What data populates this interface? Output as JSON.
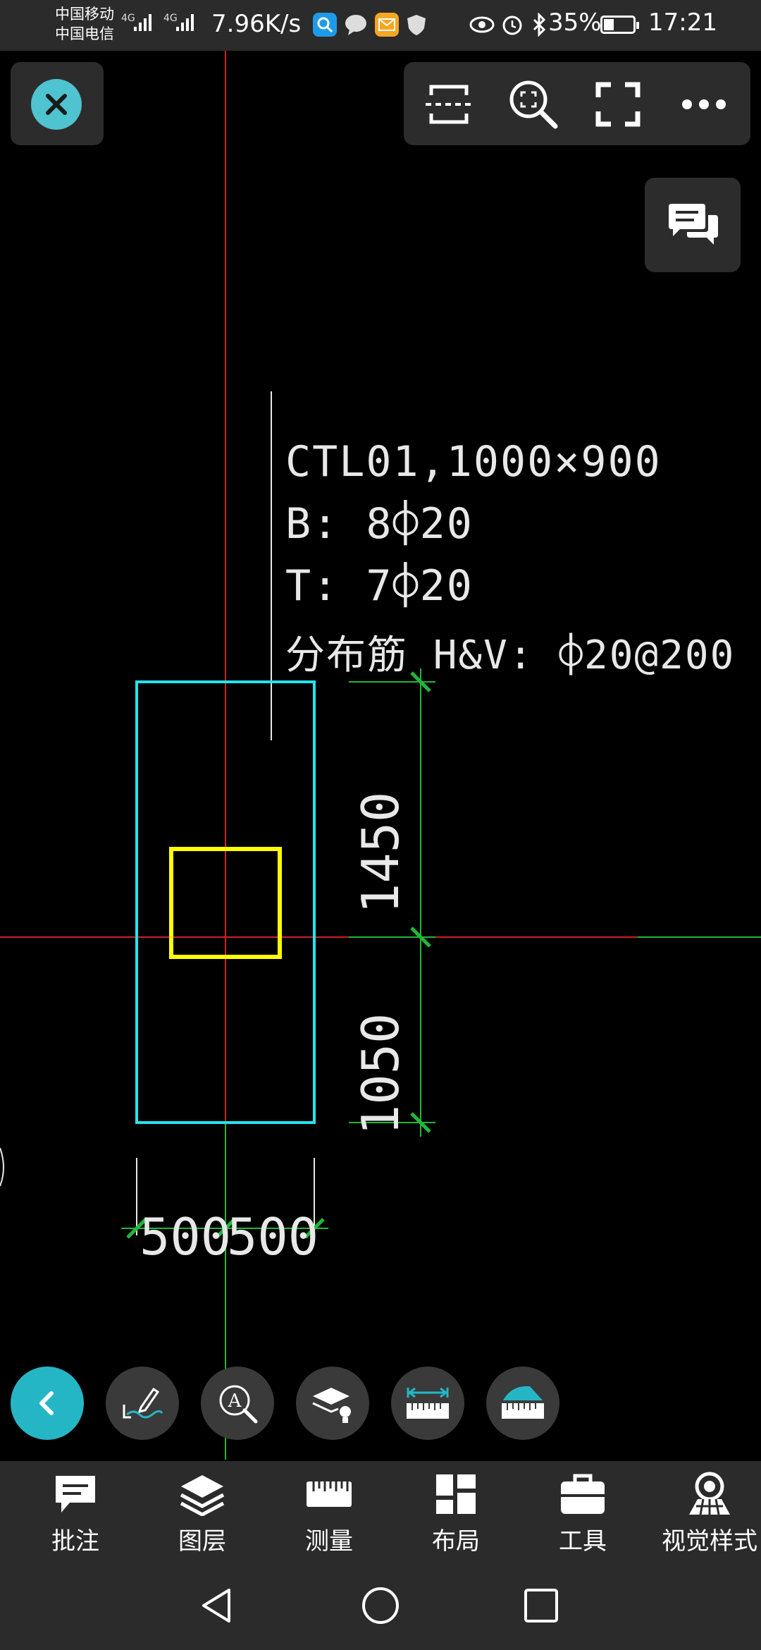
{
  "status": {
    "carrier1": "中国移动",
    "carrier2": "中国电信",
    "sig1": "4G",
    "sig2": "4G",
    "net_speed": "7.96K/s",
    "battery": "35%",
    "battery_level": 0.35,
    "time": "17:21",
    "icons": [
      "search-app-icon",
      "chat-app-icon",
      "mail-app-icon",
      "shield-app-icon",
      "eye-icon",
      "alarm-icon",
      "bluetooth-icon"
    ]
  },
  "drawing": {
    "annotation": {
      "line1": "CTL01,1000×900",
      "line2": "B: 8⌽20",
      "line3": "T: 7⌽20",
      "line4": "分布筋 H&V: ⌽20@200"
    },
    "dims": {
      "vertical_top": "1450",
      "vertical_bottom": "1050",
      "horizontal_left": "500",
      "horizontal_right": "500"
    },
    "colors": {
      "outline": "#22e5f0",
      "column": "#ffff00",
      "axis": "#d0202a",
      "dim": "#1fb83a",
      "text": "#e8e8e8"
    }
  },
  "top_toolbar": [
    "screenshot-icon",
    "zoom-fit-icon",
    "fullscreen-icon",
    "more-icon"
  ],
  "quick_tools": [
    "back-icon",
    "markup-icon",
    "text-search-icon",
    "layer-light-icon",
    "measure-length-icon",
    "measure-area-icon"
  ],
  "tabs": [
    {
      "label": "批注",
      "icon": "comment-icon"
    },
    {
      "label": "图层",
      "icon": "layers-icon"
    },
    {
      "label": "测量",
      "icon": "ruler-icon"
    },
    {
      "label": "布局",
      "icon": "layout-icon"
    },
    {
      "label": "工具",
      "icon": "toolbox-icon"
    },
    {
      "label": "视觉样式",
      "icon": "visual-style-icon"
    }
  ],
  "nav": [
    "back-nav-icon",
    "home-nav-icon",
    "recents-nav-icon"
  ]
}
